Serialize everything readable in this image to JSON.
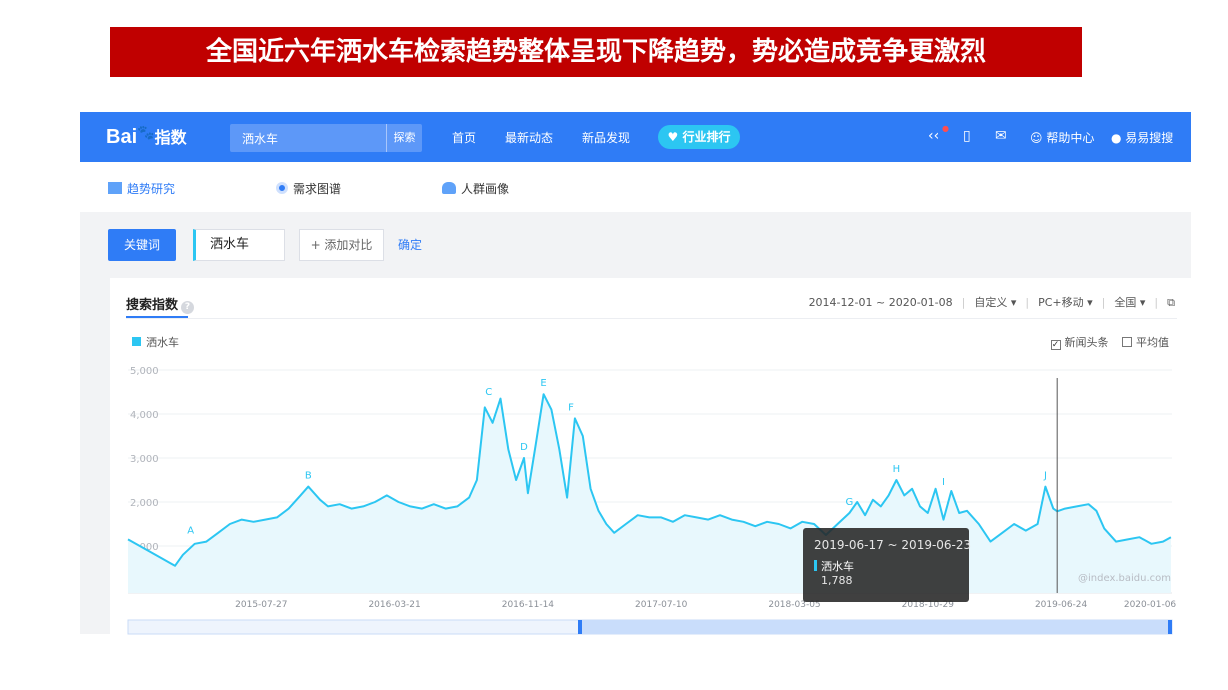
{
  "banner": {
    "title": "全国近六年洒水车检索趋势整体呈现下降趋势，势必造成竞争更激烈"
  },
  "topbar": {
    "logo_prefix": "Bai",
    "logo_suffix": "指数",
    "search_value": "洒水车",
    "search_button": "探索",
    "nav": [
      "首页",
      "最新动态",
      "新品发现"
    ],
    "pill": "行业排行",
    "help": "帮助中心",
    "user": "易易搜搜"
  },
  "subnav": {
    "items": [
      "趋势研究",
      "需求图谱",
      "人群画像"
    ]
  },
  "toolbar": {
    "keyword_tab": "关键词",
    "keyword": "洒水车",
    "add_compare": "+ 添加对比",
    "confirm": "确定"
  },
  "panel": {
    "title": "搜索指数",
    "date_range": "2014-12-01 ~ 2020-01-08",
    "custom": "自定义",
    "device": "PC+移动",
    "region": "全国",
    "legend": "洒水车",
    "opt_news": "新闻头条",
    "opt_avg": "平均值"
  },
  "tooltip": {
    "range": "2019-06-17 ~ 2019-06-23",
    "series": "洒水车",
    "value": "1,788"
  },
  "watermark": "@index.baidu.com",
  "chart_data": {
    "type": "area",
    "x_start": "2014-12-01",
    "x_end": "2020-01-08",
    "ylim": [
      0,
      5000
    ],
    "yticks": [
      "1,000",
      "2,000",
      "3,000",
      "4,000",
      "5,000"
    ],
    "xtick_labels": [
      "2015-07-27",
      "2016-03-21",
      "2016-11-14",
      "2017-07-10",
      "2018-03-05",
      "2018-10-29",
      "2019-06-24",
      "2020-01-06"
    ],
    "series": [
      {
        "name": "洒水车",
        "color": "#2cc6f2",
        "points": [
          [
            "2014-12-01",
            1150
          ],
          [
            "2014-12-15",
            1050
          ],
          [
            "2015-01-05",
            900
          ],
          [
            "2015-01-26",
            750
          ],
          [
            "2015-02-16",
            600
          ],
          [
            "2015-02-23",
            550
          ],
          [
            "2015-03-09",
            800
          ],
          [
            "2015-03-30",
            1050
          ],
          [
            "2015-04-20",
            1100
          ],
          [
            "2015-05-11",
            1300
          ],
          [
            "2015-06-01",
            1500
          ],
          [
            "2015-06-22",
            1600
          ],
          [
            "2015-07-13",
            1550
          ],
          [
            "2015-08-03",
            1600
          ],
          [
            "2015-08-24",
            1650
          ],
          [
            "2015-09-14",
            1850
          ],
          [
            "2015-10-05",
            2150
          ],
          [
            "2015-10-19",
            2350
          ],
          [
            "2015-11-09",
            2050
          ],
          [
            "2015-11-23",
            1900
          ],
          [
            "2015-12-14",
            1950
          ],
          [
            "2016-01-04",
            1850
          ],
          [
            "2016-01-25",
            1900
          ],
          [
            "2016-02-15",
            2000
          ],
          [
            "2016-03-07",
            2150
          ],
          [
            "2016-03-28",
            2000
          ],
          [
            "2016-04-18",
            1900
          ],
          [
            "2016-05-09",
            1850
          ],
          [
            "2016-05-30",
            1950
          ],
          [
            "2016-06-20",
            1850
          ],
          [
            "2016-07-11",
            1900
          ],
          [
            "2016-08-01",
            2100
          ],
          [
            "2016-08-15",
            2500
          ],
          [
            "2016-08-29",
            4150
          ],
          [
            "2016-09-12",
            3800
          ],
          [
            "2016-09-26",
            4350
          ],
          [
            "2016-10-10",
            3200
          ],
          [
            "2016-10-24",
            2500
          ],
          [
            "2016-11-07",
            3000
          ],
          [
            "2016-11-14",
            2200
          ],
          [
            "2016-11-28",
            3300
          ],
          [
            "2016-12-12",
            4450
          ],
          [
            "2016-12-26",
            4100
          ],
          [
            "2017-01-09",
            3200
          ],
          [
            "2017-01-23",
            2100
          ],
          [
            "2017-02-06",
            3900
          ],
          [
            "2017-02-20",
            3500
          ],
          [
            "2017-03-06",
            2300
          ],
          [
            "2017-03-20",
            1800
          ],
          [
            "2017-04-03",
            1500
          ],
          [
            "2017-04-17",
            1300
          ],
          [
            "2017-05-08",
            1500
          ],
          [
            "2017-05-29",
            1700
          ],
          [
            "2017-06-19",
            1650
          ],
          [
            "2017-07-10",
            1650
          ],
          [
            "2017-07-31",
            1550
          ],
          [
            "2017-08-21",
            1700
          ],
          [
            "2017-09-11",
            1650
          ],
          [
            "2017-10-02",
            1600
          ],
          [
            "2017-10-23",
            1700
          ],
          [
            "2017-11-13",
            1600
          ],
          [
            "2017-12-04",
            1550
          ],
          [
            "2017-12-25",
            1450
          ],
          [
            "2018-01-15",
            1550
          ],
          [
            "2018-02-05",
            1500
          ],
          [
            "2018-02-26",
            1400
          ],
          [
            "2018-03-19",
            1550
          ],
          [
            "2018-04-09",
            1500
          ],
          [
            "2018-04-30",
            1250
          ],
          [
            "2018-05-21",
            1500
          ],
          [
            "2018-06-11",
            1750
          ],
          [
            "2018-06-25",
            2000
          ],
          [
            "2018-07-09",
            1700
          ],
          [
            "2018-07-23",
            2050
          ],
          [
            "2018-08-06",
            1900
          ],
          [
            "2018-08-20",
            2150
          ],
          [
            "2018-09-03",
            2500
          ],
          [
            "2018-09-17",
            2150
          ],
          [
            "2018-10-01",
            2300
          ],
          [
            "2018-10-15",
            1900
          ],
          [
            "2018-10-29",
            1750
          ],
          [
            "2018-11-12",
            2300
          ],
          [
            "2018-11-26",
            1600
          ],
          [
            "2018-12-10",
            2250
          ],
          [
            "2018-12-24",
            1750
          ],
          [
            "2019-01-07",
            1800
          ],
          [
            "2019-01-28",
            1500
          ],
          [
            "2019-02-18",
            1100
          ],
          [
            "2019-03-11",
            1300
          ],
          [
            "2019-04-01",
            1500
          ],
          [
            "2019-04-22",
            1350
          ],
          [
            "2019-05-13",
            1500
          ],
          [
            "2019-05-27",
            2350
          ],
          [
            "2019-06-10",
            1850
          ],
          [
            "2019-06-17",
            1788
          ],
          [
            "2019-07-01",
            1850
          ],
          [
            "2019-07-22",
            1900
          ],
          [
            "2019-08-12",
            1950
          ],
          [
            "2019-08-26",
            1800
          ],
          [
            "2019-09-09",
            1400
          ],
          [
            "2019-09-30",
            1100
          ],
          [
            "2019-10-21",
            1150
          ],
          [
            "2019-11-11",
            1200
          ],
          [
            "2019-12-02",
            1050
          ],
          [
            "2019-12-23",
            1100
          ],
          [
            "2020-01-06",
            1200
          ]
        ]
      }
    ],
    "annotations": [
      {
        "label": "A",
        "date": "2015-03-23",
        "value": 1100
      },
      {
        "label": "B",
        "date": "2015-10-19",
        "value": 2350
      },
      {
        "label": "C",
        "date": "2016-09-05",
        "value": 4250
      },
      {
        "label": "D",
        "date": "2016-11-07",
        "value": 3000
      },
      {
        "label": "E",
        "date": "2016-12-12",
        "value": 4450
      },
      {
        "label": "F",
        "date": "2017-01-30",
        "value": 3900
      },
      {
        "label": "G",
        "date": "2018-06-11",
        "value": 1750
      },
      {
        "label": "H",
        "date": "2018-09-03",
        "value": 2500
      },
      {
        "label": "I",
        "date": "2018-11-26",
        "value": 2200
      },
      {
        "label": "J",
        "date": "2019-05-27",
        "value": 2350
      }
    ],
    "hover_date": "2019-06-17"
  }
}
